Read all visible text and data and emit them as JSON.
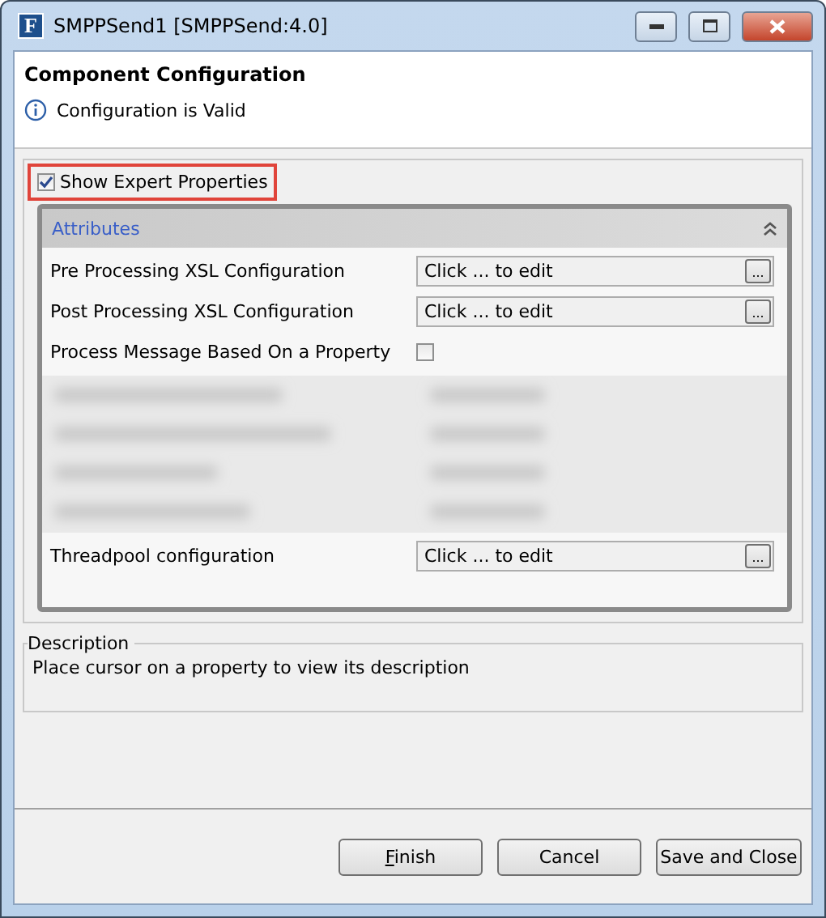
{
  "window": {
    "title": "SMPPSend1 [SMPPSend:4.0]",
    "app_letter": "F"
  },
  "header": {
    "title": "Component Configuration",
    "status": "Configuration is Valid"
  },
  "expert": {
    "label": "Show Expert Properties",
    "checked": true,
    "highlighted": true
  },
  "attributes": {
    "title": "Attributes",
    "expanded": true,
    "rows": [
      {
        "kind": "editor",
        "label": "Pre Processing XSL Configuration",
        "value": "Click ... to edit",
        "button": "..."
      },
      {
        "kind": "editor",
        "label": "Post Processing XSL Configuration",
        "value": "Click ... to edit",
        "button": "..."
      },
      {
        "kind": "checkbox",
        "label": "Process Message Based On a Property",
        "checked": false
      },
      {
        "kind": "redacted"
      },
      {
        "kind": "editor",
        "label": "Threadpool configuration",
        "value": "Click ... to edit",
        "button": "..."
      }
    ]
  },
  "description": {
    "title": "Description",
    "text": "Place cursor on a property to view its description"
  },
  "buttons": [
    {
      "label": "Finish",
      "first_letter_underlined": true
    },
    {
      "label": "Cancel"
    },
    {
      "label": "Save and Close"
    }
  ]
}
